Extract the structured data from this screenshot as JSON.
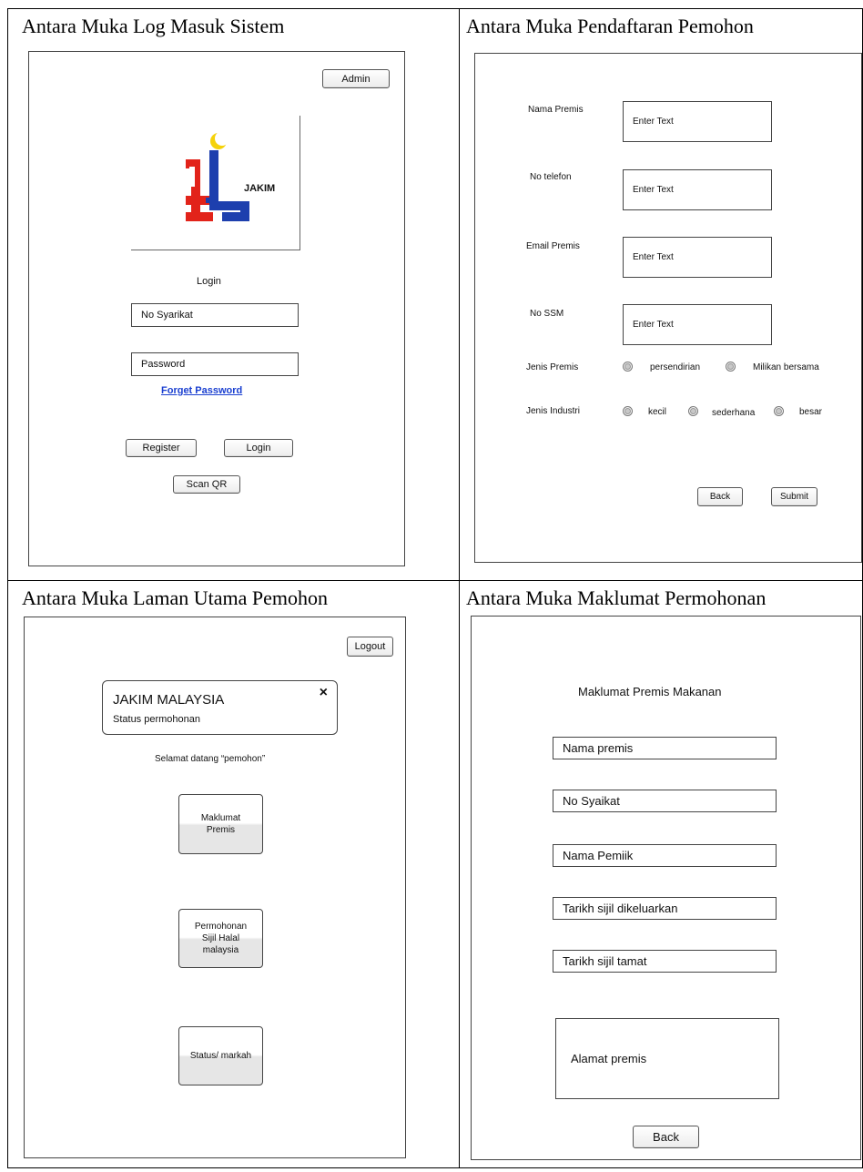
{
  "panels": {
    "login_title": "Antara Muka Log Masuk Sistem",
    "register_title": "Antara Muka Pendaftaran Pemohon",
    "home_title": "Antara Muka Laman Utama Pemohon",
    "info_title": "Antara Muka Maklumat Permohonan"
  },
  "login": {
    "admin_label": "Admin",
    "logo_text": "JAKIM",
    "heading": "Login",
    "company_no_placeholder": "No Syarikat",
    "password_placeholder": "Password",
    "forget_link": "Forget Password",
    "register_label": "Register",
    "login_label": "Login",
    "scan_label": "Scan QR"
  },
  "register": {
    "fields": [
      {
        "label": "Nama Premis",
        "value": "Enter Text"
      },
      {
        "label": "No telefon",
        "value": "Enter Text"
      },
      {
        "label": "Email Premis",
        "value": "Enter Text"
      },
      {
        "label": "No SSM",
        "value": "Enter Text"
      }
    ],
    "premis_type_label": "Jenis Premis",
    "premis_options": [
      "persendirian",
      "Milikan bersama"
    ],
    "industry_label": "Jenis Industri",
    "industry_options": [
      "kecil",
      "sederhana",
      "besar"
    ],
    "back_label": "Back",
    "submit_label": "Submit"
  },
  "home": {
    "logout_label": "Logout",
    "notice_title": "JAKIM MALAYSIA",
    "notice_sub": "Status permohonan",
    "close_glyph": "×",
    "welcome": "Selamat datang “pemohon”",
    "tiles": [
      {
        "label": "Maklumat\nPremis"
      },
      {
        "label": "Permohonan\nSijil Halal\nmalaysia"
      },
      {
        "label": "Status/ markah"
      }
    ]
  },
  "info": {
    "heading": "Maklumat Premis Makanan",
    "fields": [
      "Nama premis",
      "No Syaikat",
      "Nama Pemiik",
      "Tarikh sijil dikeluarkan",
      "Tarikh sijil tamat"
    ],
    "address": "Alamat premis",
    "back_label": "Back"
  },
  "colors": {
    "logo_red": "#e2231a",
    "logo_blue": "#1d3fae",
    "logo_yellow": "#f5d20a",
    "link_blue": "#1a3fd0"
  }
}
